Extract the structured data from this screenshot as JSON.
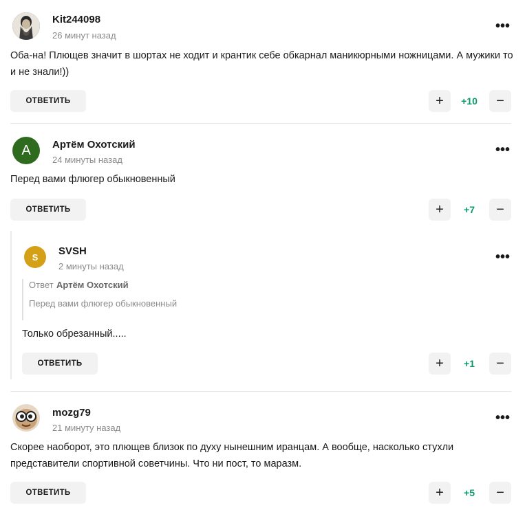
{
  "comments": [
    {
      "author": "Kit244098",
      "time": "26 минут назад",
      "text_line1": "Оба-на! Плющев значит в шортах не ходит и крантик себе обкарнал маникюрными ножницами. А мужики то",
      "text_line2": "и не знали!))",
      "reply_label": "ОТВЕТИТЬ",
      "score": "+10"
    },
    {
      "author": "Артём Охотский",
      "avatar_letter": "А",
      "avatar_color": "#2e6b1f",
      "time": "24 минуты назад",
      "text_line1": "Перед вами флюгер обыкновенный",
      "reply_label": "ОТВЕТИТЬ",
      "score": "+7"
    },
    {
      "author": "SVSH",
      "avatar_letter": "S",
      "avatar_color": "#d4a017",
      "time": "2 минуты назад",
      "quote_prefix": "Ответ",
      "quote_author": "Артём Охотский",
      "quote_text": "Перед вами флюгер обыкновенный",
      "text_line1": "Только обрезанный.....",
      "reply_label": "ОТВЕТИТЬ",
      "score": "+1"
    },
    {
      "author": "mozg79",
      "time": "21 минуту назад",
      "text_line1": "Скорее наоборот, это плющев близок по духу нынешним иранцам. А вообще, насколько стухли",
      "text_line2": "представители спортивной советчины. Что ни пост, то маразм.",
      "reply_label": "ОТВЕТИТЬ",
      "score": "+5"
    }
  ],
  "icons": {
    "more": "•••",
    "plus": "+",
    "minus": "−"
  },
  "colors": {
    "score": "#0a9a6a",
    "button_bg": "#f2f2f2"
  }
}
